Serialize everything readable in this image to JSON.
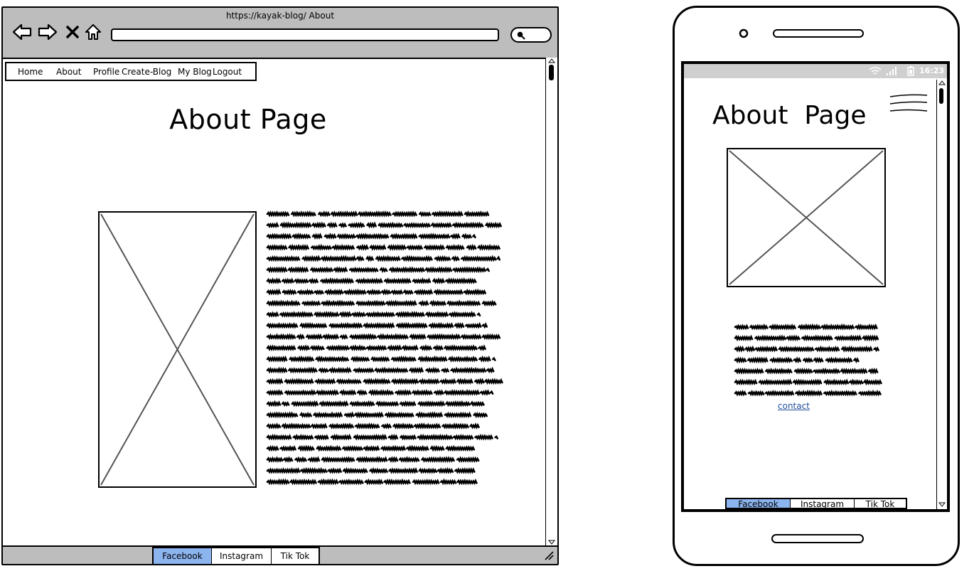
{
  "desktop": {
    "url": "https://kayak-blog/ About",
    "nav": [
      "Home",
      "About",
      "Profile",
      "Create-Blog",
      "My Blog",
      "Logout"
    ],
    "page_title": "About Page",
    "social": [
      {
        "label": "Facebook",
        "active": true
      },
      {
        "label": "Instagram",
        "active": false
      },
      {
        "label": "Tik Tok",
        "active": false
      }
    ]
  },
  "mobile": {
    "status_time": "16:23",
    "page_title": "About  Page",
    "contact_link": "contact",
    "social": [
      {
        "label": "Facebook",
        "active": true
      },
      {
        "label": "Instagram",
        "active": false
      },
      {
        "label": "Tik Tok",
        "active": false
      }
    ]
  },
  "colors": {
    "chrome_gray": "#bdbdbd",
    "active_button": "#8cb4ef",
    "link": "#1f4e9c"
  },
  "icons": [
    "back-arrow-icon",
    "forward-arrow-icon",
    "stop-icon",
    "home-icon",
    "search-icon",
    "hamburger-menu-icon",
    "resize-grip-icon",
    "wifi-icon",
    "signal-icon",
    "battery-icon"
  ]
}
